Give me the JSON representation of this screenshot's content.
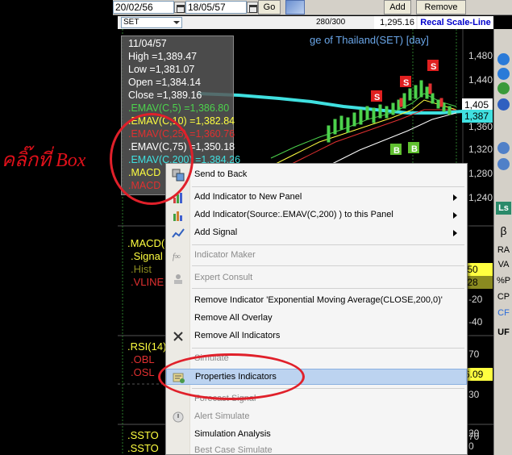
{
  "annotation": {
    "text": "คลิ๊กที่ Box"
  },
  "toolbar": {
    "start_date": "20/02/56",
    "end_date": "18/05/57",
    "go_label": "Go",
    "add_label": "Add",
    "remove_label": "Remove"
  },
  "status": {
    "symbol": "SET",
    "count": "280/300",
    "last_price": "1,295.16",
    "recal_label": "Recal Scale-Line"
  },
  "chart": {
    "title": "ge of Thailand(SET) [day]",
    "axis_labels": [
      "1,480",
      "1,440",
      "1,360",
      "1,320",
      "1,280",
      "1,240"
    ],
    "tag_405": "1,405",
    "tag_387": "1,387",
    "signal_marker_sell": "S",
    "signal_marker_buy": "B",
    "colors": {
      "ema5": "#4cd24c",
      "ema10": "#ffff40",
      "ema25": "#e03030",
      "ema75": "#ffffff",
      "ema200": "#40e0e0",
      "sell": "#e02020",
      "buy": "#60c030"
    }
  },
  "info_box": {
    "date": "11/04/57",
    "high": "High  =1,389.47",
    "low": "Low  =1,381.07",
    "open": "Open  =1,384.14",
    "close": "Close  =1,389.16",
    "ema5": ".EMAV(C,5)   =1,386.80",
    "ema10": ".EMAV(C,10)   =1,382.84",
    "ema25": ".EMAV(C,25)   =1,360.76",
    "ema75": ".EMAV(C,75)   =1,350.18",
    "ema200": ".EMAV(C,200)  =1,384.26",
    "macd1": ".MACD",
    "macd2": ".MACD"
  },
  "panels": {
    "macd": {
      "name": ".MACD(",
      "signal": ".Signal",
      "hist": ".Hist",
      "vline": ".VLINE",
      "value1": ".50",
      "value2": ".28"
    },
    "rsi": {
      "name": ".RSI(14)",
      "obl": ".OBL",
      "osl": ".OSL",
      "value": "6.09",
      "tick70": "70",
      "tick30": "30"
    },
    "ssto": {
      "name1": ".SSTO",
      "name2": ".SSTO"
    },
    "macd_ticks": [
      "-20",
      "-40"
    ],
    "lower_ticks": [
      "20",
      "0",
      "70"
    ]
  },
  "right_toolbar": {
    "ls": "Ls",
    "beta": "β",
    "ra": "RA",
    "va": "VA",
    "pp": "%P",
    "cp": "CP",
    "cf": "CF",
    "uf": "UF"
  },
  "context_menu": {
    "items": [
      {
        "label": "Send to Back",
        "icon": "send-to-back-icon"
      },
      {
        "label": "Add Indicator to New Panel",
        "icon": "indicator-panel-icon"
      },
      {
        "label": "Add Indicator(Source:.EMAV(C,200) ) to this Panel",
        "icon": "indicator-add-icon"
      },
      {
        "label": "Add Signal",
        "icon": "signal-icon"
      },
      {
        "label": "Indicator Maker",
        "icon": "formula-icon"
      },
      {
        "label": "Expert Consult",
        "icon": "expert-icon"
      },
      {
        "label": "Remove Indicator 'Exponential Moving Average(CLOSE,200,0)'"
      },
      {
        "label": "Remove All Overlay"
      },
      {
        "label": "Remove All Indicators",
        "icon": "close-icon"
      },
      {
        "label": "Simulate"
      },
      {
        "label": "Properties Indicators",
        "icon": "properties-icon"
      },
      {
        "label": "Forecast Signal"
      },
      {
        "label": "Alert Simulate",
        "icon": "alert-icon"
      },
      {
        "label": "Simulation Analysis"
      },
      {
        "label": "Best Case Simulate"
      }
    ]
  }
}
